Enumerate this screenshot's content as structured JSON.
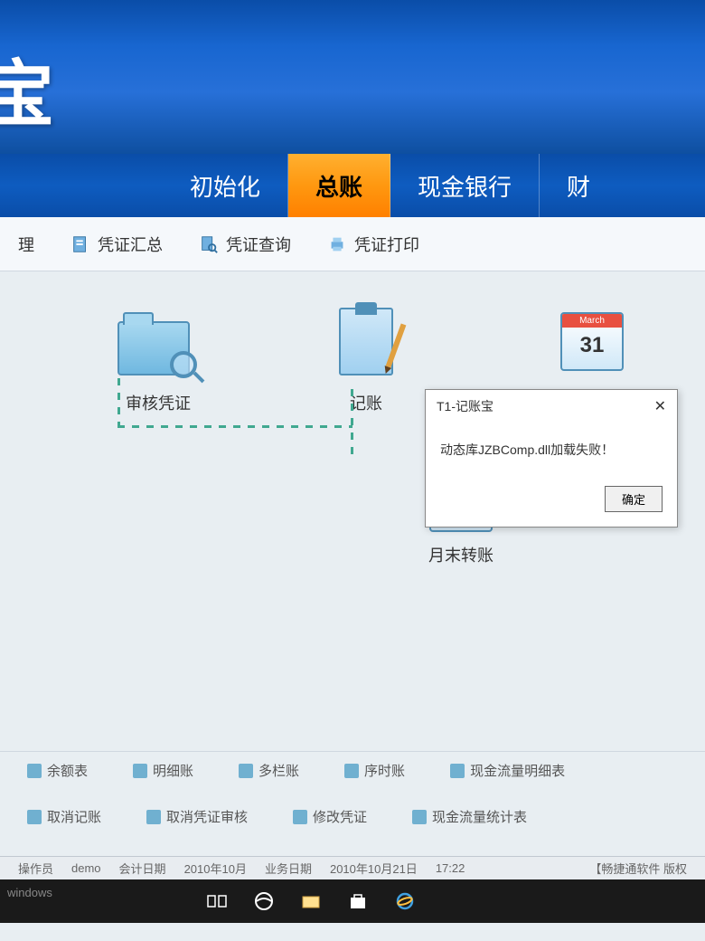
{
  "header": {
    "logo_fragment": "宝"
  },
  "nav": {
    "items": [
      "初始化",
      "总账",
      "现金银行",
      "财"
    ],
    "active_index": 1
  },
  "toolbar": {
    "items": [
      "理",
      "凭证汇总",
      "凭证查询",
      "凭证打印"
    ]
  },
  "workflow": {
    "audit_voucher": "审核凭证",
    "post_account": "记账",
    "month_end": "月末转账",
    "calendar_month": "March",
    "calendar_day": "31"
  },
  "dialog": {
    "title": "T1-记账宝",
    "message": "动态库JZBComp.dll加载失败！",
    "ok": "确定"
  },
  "bottom_links": {
    "row1": [
      "余额表",
      "明细账",
      "多栏账",
      "序时账",
      "现金流量明细表"
    ],
    "row2": [
      "取消记账",
      "取消凭证审核",
      "修改凭证",
      "现金流量统计表"
    ]
  },
  "status": {
    "operator_label": "操作员",
    "operator": "demo",
    "account_date_label": "会计日期",
    "account_date": "2010年10月",
    "biz_date_label": "业务日期",
    "biz_date": "2010年10月21日",
    "time": "17:22",
    "right_text": "【畅捷通软件 版权"
  },
  "watermark": "windows"
}
